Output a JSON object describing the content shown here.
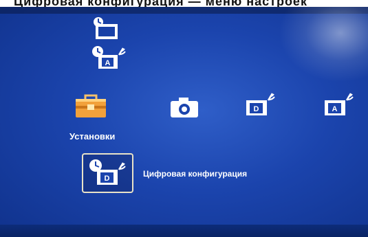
{
  "caption": {
    "text": "Цифровая конфигурация — меню настроек"
  },
  "sidebar_icons": [
    {
      "icon": "clock-box-icon"
    },
    {
      "icon": "analog-antenna-clock-icon",
      "letter": "A"
    }
  ],
  "menu": {
    "items": [
      {
        "icon": "toolbox-icon",
        "label": "Установки",
        "active": true
      },
      {
        "icon": "camera-icon"
      },
      {
        "icon": "digital-antenna-icon",
        "letter": "D"
      },
      {
        "icon": "analog-antenna-icon",
        "letter": "A"
      }
    ]
  },
  "submenu": {
    "selected": {
      "icon": "digital-antenna-clock-icon",
      "letter": "D",
      "label": "Цифровая конфигурация"
    }
  },
  "colors": {
    "background": "#1b44ad",
    "text": "#ffffff",
    "toolbox_orange": "#f2a13b",
    "selection_border": "#e9e3c8"
  }
}
